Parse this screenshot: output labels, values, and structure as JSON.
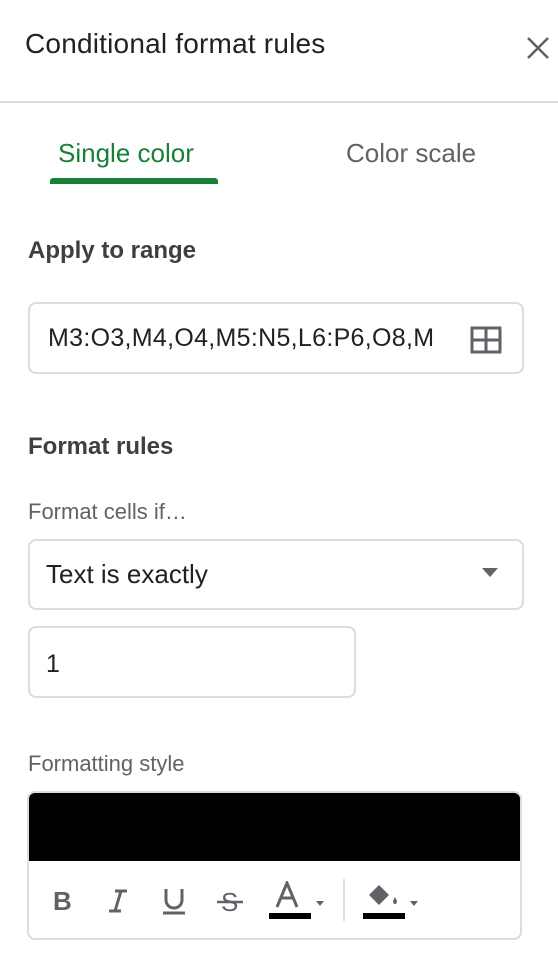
{
  "panel": {
    "title": "Conditional format rules",
    "close_icon": "close-icon"
  },
  "tabs": [
    {
      "label": "Single color",
      "active": true
    },
    {
      "label": "Color scale",
      "active": false
    }
  ],
  "apply_range": {
    "title": "Apply to range",
    "value": "M3:O3,M4,O4,M5:N5,L6:P6,O8,M",
    "icon": "grid-select-icon"
  },
  "format_rules": {
    "title": "Format rules",
    "cells_if_label": "Format cells if…",
    "condition": "Text is exactly",
    "value": "1"
  },
  "formatting_style": {
    "label": "Formatting style",
    "preview_color": "#000000",
    "toolbar": [
      "bold-icon",
      "italic-icon",
      "underline-icon",
      "strikethrough-icon",
      "text-color-icon",
      "fill-color-icon"
    ]
  },
  "colors": {
    "accent": "#188038",
    "border": "#dadce0",
    "muted_text": "#5f6368"
  }
}
